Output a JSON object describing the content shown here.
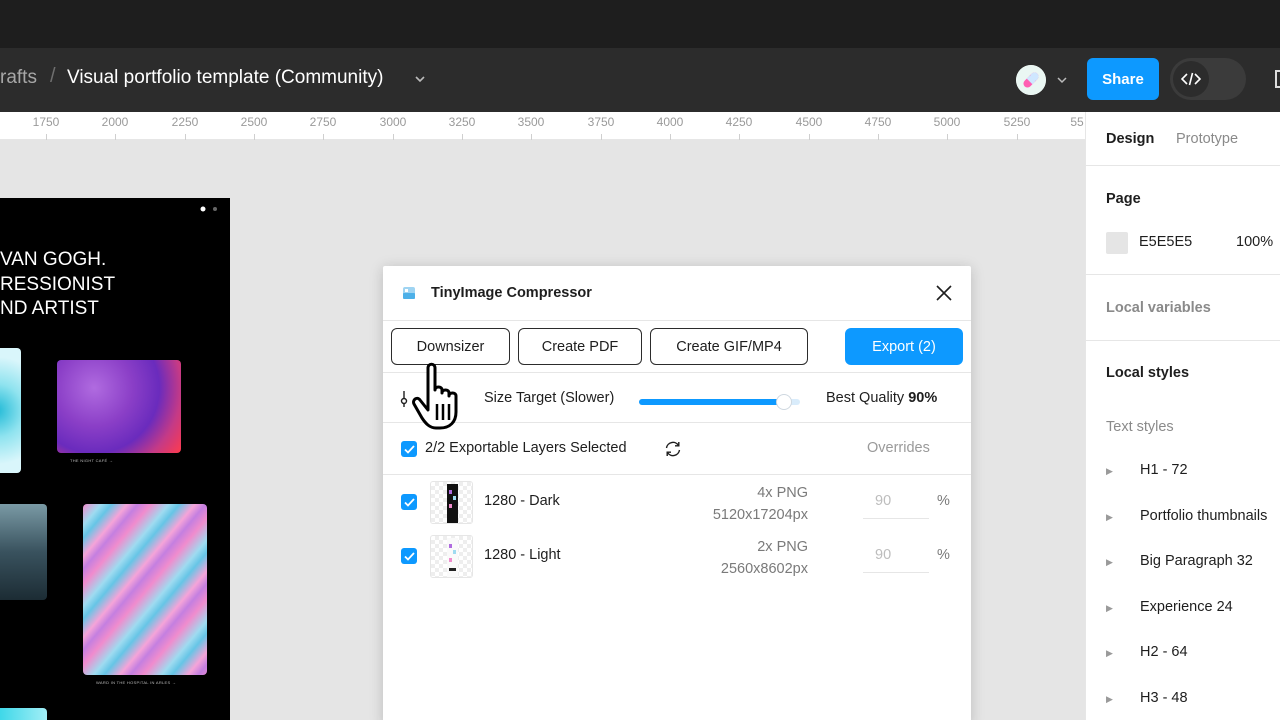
{
  "toolbar": {
    "breadcrumb_prev": "rafts",
    "breadcrumb_sep": "/",
    "file_title": "Visual portfolio template (Community)",
    "share_label": "Share",
    "devmode_icon": "code-icon"
  },
  "ruler": {
    "marks": [
      "1750",
      "2000",
      "2250",
      "2500",
      "2750",
      "3000",
      "3250",
      "3500",
      "3750",
      "4000",
      "4250",
      "4500",
      "4750",
      "5000",
      "5250",
      "55"
    ]
  },
  "canvas": {
    "frame_headline": "VAN GOGH.\nRESSIONIST\nND ARTIST",
    "caption_1": "THE NIGHT CAFÉ →",
    "caption_2": "WARD IN THE HOSPITAL IN ARLES →"
  },
  "plugin": {
    "title": "TinyImage Compressor",
    "tabs": [
      "Downsizer",
      "Create PDF",
      "Create GIF/MP4"
    ],
    "export_label": "Export (2)",
    "size_target_label": "Size Target (Slower)",
    "quality_label": "Best Quality",
    "quality_value": "90%",
    "quality_slider_fraction": 0.9,
    "select_label": "2/2 Exportable Layers Selected",
    "overrides_label": "Overrides",
    "layers": [
      {
        "name": "1280 - Dark",
        "format": "4x PNG",
        "size": "5120x17204px",
        "quality": "90",
        "unit": "%",
        "selected": true
      },
      {
        "name": "1280 - Light",
        "format": "2x PNG",
        "size": "2560x8602px",
        "quality": "90",
        "unit": "%",
        "selected": true
      }
    ]
  },
  "panel": {
    "tab_design": "Design",
    "tab_prototype": "Prototype",
    "page_heading": "Page",
    "page_color": "E5E5E5",
    "page_opacity": "100%",
    "local_variables": "Local variables",
    "local_styles": "Local styles",
    "text_styles": "Text styles",
    "styles": [
      "H1 - 72",
      "Portfolio thumbnails",
      "Big Paragraph 32",
      "Experience 24",
      "H2 - 64",
      "H3 - 48"
    ]
  },
  "colors": {
    "accent": "#0d99ff",
    "toolbar_bg": "#2c2c2c",
    "canvas_bg": "#e5e5e5"
  }
}
